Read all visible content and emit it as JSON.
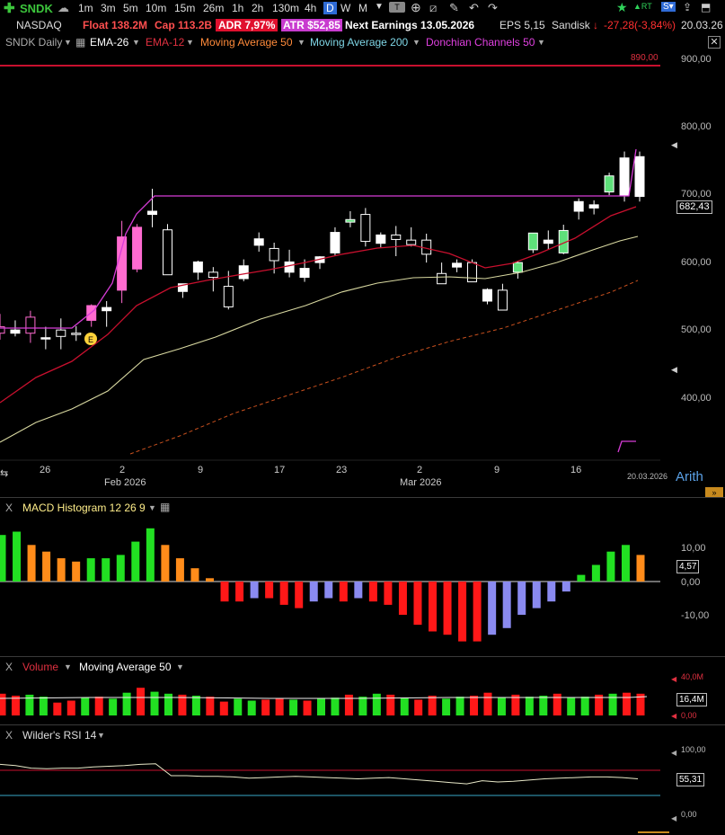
{
  "toolbar": {
    "plus_icon": "plus-icon",
    "symbol": "SNDK",
    "timeframes": [
      "1m",
      "3m",
      "5m",
      "10m",
      "15m",
      "26m",
      "1h",
      "2h",
      "130m",
      "4h",
      "D",
      "W",
      "M"
    ],
    "active_timeframe": "D",
    "right_labels": {
      "rt": "RT",
      "s": "S"
    }
  },
  "info": {
    "exchange": "NASDAQ",
    "float": "Float 138.2M",
    "cap": "Cap 113.2B",
    "adr": "ADR  7,97%",
    "atr": "ATR $52,85",
    "earnings": "Next Earnings 13.05.2026",
    "eps": "EPS 5,15",
    "company": "Sandisk",
    "change": "-27,28(-3,84%)",
    "date": "20.03.26"
  },
  "indicators": {
    "chart_name": "SNDK Daily",
    "ema26": "EMA-26",
    "ema12": "EMA-12",
    "ma50": "Moving Average 50",
    "ma200": "Moving Average 200",
    "donchian": "Donchian Channels 50"
  },
  "price_axis": {
    "ticks": [
      "900,00",
      "800,00",
      "700,00",
      "600,00",
      "500,00",
      "400,00"
    ],
    "last_price": "682,43",
    "line_label": "890,00",
    "scale_mode": "Arith"
  },
  "date_axis": {
    "labels": [
      "26",
      "2",
      "9",
      "17",
      "23",
      "2",
      "9",
      "16"
    ],
    "month_labels": [
      "Feb 2026",
      "Mar 2026"
    ],
    "end_date": "20.03.2026",
    "earnings_marker": "E"
  },
  "macd": {
    "title": "MACD Histogram 12 26 9",
    "ticks": [
      "10,00",
      "0,00",
      "-10,00"
    ],
    "current": "4,57",
    "close": "X"
  },
  "volume": {
    "title": "Volume",
    "ma_title": "Moving Average 50",
    "ticks": [
      "40,0M",
      "0,00"
    ],
    "current": "16,4M",
    "close": "X"
  },
  "rsi": {
    "title": "Wilder's RSI 14",
    "ticks": [
      "100,00",
      "0,00"
    ],
    "current": "55,31",
    "close": "X"
  },
  "colors": {
    "up": "#ffffff",
    "down": "#000000",
    "green_candle": "#5ee07a",
    "pink_candle": "#ff6bd0",
    "red_line": "#c8102e",
    "donchian": "#d63cd6",
    "ma50": "#d8d8a0",
    "ma200": "#c8501e"
  },
  "chart_data": [
    {
      "type": "candlestick",
      "title": "SNDK Daily",
      "ylim": [
        300,
        930
      ],
      "candles": [
        {
          "o": 505,
          "h": 525,
          "l": 485,
          "c": 495
        },
        {
          "o": 495,
          "h": 515,
          "l": 490,
          "c": 500
        },
        {
          "o": 520,
          "h": 530,
          "l": 480,
          "c": 495
        },
        {
          "o": 488,
          "h": 505,
          "l": 470,
          "c": 488
        },
        {
          "o": 500,
          "h": 518,
          "l": 470,
          "c": 490
        },
        {
          "o": 495,
          "h": 506,
          "l": 483,
          "c": 494
        },
        {
          "o": 515,
          "h": 540,
          "l": 505,
          "c": 538
        },
        {
          "o": 530,
          "h": 545,
          "l": 505,
          "c": 535
        },
        {
          "o": 562,
          "h": 670,
          "l": 542,
          "c": 645
        },
        {
          "o": 595,
          "h": 665,
          "l": 590,
          "c": 660
        },
        {
          "o": 680,
          "h": 720,
          "l": 660,
          "c": 685
        },
        {
          "o": 656,
          "h": 665,
          "l": 590,
          "c": 586
        },
        {
          "o": 560,
          "h": 572,
          "l": 550,
          "c": 572
        },
        {
          "o": 590,
          "h": 608,
          "l": 578,
          "c": 606
        },
        {
          "o": 590,
          "h": 598,
          "l": 560,
          "c": 582
        },
        {
          "o": 568,
          "h": 592,
          "l": 532,
          "c": 536
        },
        {
          "o": 580,
          "h": 610,
          "l": 576,
          "c": 600
        },
        {
          "o": 632,
          "h": 652,
          "l": 622,
          "c": 642
        },
        {
          "o": 627,
          "h": 636,
          "l": 588,
          "c": 608
        },
        {
          "o": 590,
          "h": 625,
          "l": 582,
          "c": 606
        },
        {
          "o": 582,
          "h": 610,
          "l": 575,
          "c": 596
        },
        {
          "o": 605,
          "h": 615,
          "l": 595,
          "c": 614
        },
        {
          "o": 620,
          "h": 660,
          "l": 615,
          "c": 652
        },
        {
          "o": 668,
          "h": 685,
          "l": 660,
          "c": 672
        },
        {
          "o": 680,
          "h": 690,
          "l": 630,
          "c": 638
        },
        {
          "o": 635,
          "h": 652,
          "l": 628,
          "c": 648
        },
        {
          "o": 648,
          "h": 662,
          "l": 615,
          "c": 641
        },
        {
          "o": 640,
          "h": 660,
          "l": 630,
          "c": 633
        },
        {
          "o": 640,
          "h": 650,
          "l": 605,
          "c": 618
        },
        {
          "o": 588,
          "h": 605,
          "l": 572,
          "c": 572
        },
        {
          "o": 598,
          "h": 610,
          "l": 590,
          "c": 604
        },
        {
          "o": 605,
          "h": 610,
          "l": 575,
          "c": 575
        },
        {
          "o": 545,
          "h": 565,
          "l": 540,
          "c": 563
        },
        {
          "o": 562,
          "h": 572,
          "l": 540,
          "c": 531
        },
        {
          "o": 590,
          "h": 607,
          "l": 580,
          "c": 605
        },
        {
          "o": 625,
          "h": 648,
          "l": 620,
          "c": 651
        },
        {
          "o": 635,
          "h": 655,
          "l": 625,
          "c": 640
        },
        {
          "o": 620,
          "h": 664,
          "l": 618,
          "c": 655
        },
        {
          "o": 685,
          "h": 705,
          "l": 672,
          "c": 700
        },
        {
          "o": 690,
          "h": 702,
          "l": 680,
          "c": 695
        },
        {
          "o": 715,
          "h": 745,
          "l": 710,
          "c": 740
        },
        {
          "o": 710,
          "h": 778,
          "l": 700,
          "c": 768
        },
        {
          "o": 708,
          "h": 778,
          "l": 700,
          "c": 770
        }
      ]
    },
    {
      "type": "bar",
      "title": "MACD Histogram 12 26 9",
      "ylim": [
        -20,
        20
      ],
      "values": [
        14,
        15,
        11,
        9,
        7,
        6,
        7,
        7,
        8,
        12,
        16,
        11,
        7,
        4,
        1,
        -6,
        -6,
        -5,
        -5,
        -7,
        -8,
        -6,
        -5,
        -6,
        -5,
        -6,
        -7,
        -10,
        -13,
        -15,
        -16,
        -18,
        -18,
        -16,
        -14,
        -10,
        -8,
        -6,
        -3,
        2,
        5,
        9,
        11,
        8
      ]
    },
    {
      "type": "bar",
      "title": "Volume",
      "ylim": [
        0,
        40
      ],
      "values": [
        22,
        20,
        21,
        19,
        13,
        15,
        18,
        19,
        17,
        23,
        28,
        24,
        22,
        21,
        20,
        19,
        14,
        17,
        15,
        16,
        17,
        16,
        15,
        17,
        18,
        21,
        19,
        22,
        21,
        18,
        16,
        20,
        17,
        19,
        20,
        23,
        18,
        21,
        19,
        20,
        22,
        18,
        19,
        21,
        22,
        23,
        22
      ]
    },
    {
      "type": "line",
      "title": "Wilder's RSI 14",
      "ylim": [
        0,
        100
      ],
      "values": [
        78,
        76,
        72,
        71,
        72,
        72,
        74,
        75,
        76,
        78,
        79,
        60,
        60,
        59,
        59,
        58,
        56,
        57,
        58,
        59,
        58,
        57,
        56,
        55,
        56,
        57,
        55,
        53,
        51,
        49,
        47,
        52,
        50,
        51,
        53,
        55,
        56,
        57,
        58,
        58,
        57,
        55
      ]
    }
  ]
}
